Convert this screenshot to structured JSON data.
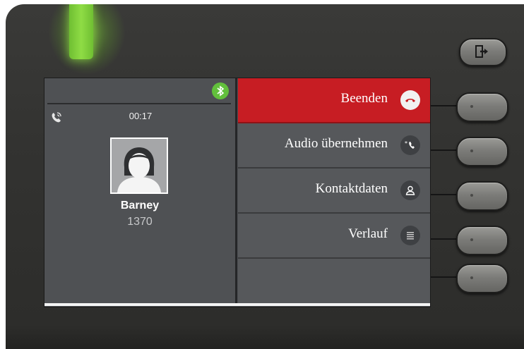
{
  "call": {
    "timer": "00:17",
    "contact_name": "Barney",
    "contact_number": "1370"
  },
  "menu": {
    "items": [
      {
        "label": "Beenden",
        "icon": "hang-up-icon",
        "active": true
      },
      {
        "label": "Audio übernehmen",
        "icon": "take-audio-icon",
        "active": false
      },
      {
        "label": "Kontaktdaten",
        "icon": "contact-icon",
        "active": false
      },
      {
        "label": "Verlauf",
        "icon": "list-icon",
        "active": false
      }
    ]
  },
  "status": {
    "bluetooth_icon": "bluetooth-icon",
    "led_color": "#8fdc45"
  },
  "colors": {
    "accent_red": "#c71d23",
    "bluetooth_green": "#62c03c"
  }
}
